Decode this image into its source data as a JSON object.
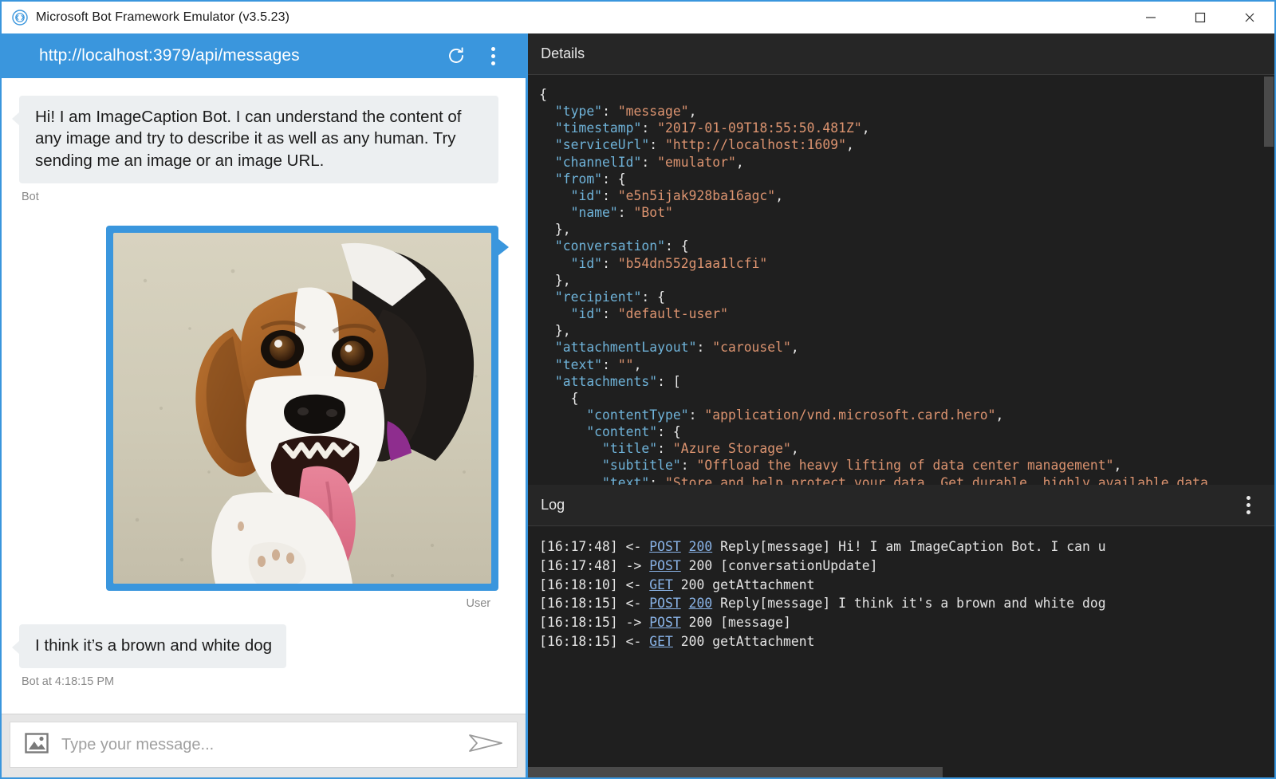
{
  "window": {
    "title": "Microsoft Bot Framework Emulator (v3.5.23)",
    "logo_icon": "bot-framework-logo-icon",
    "minimize_label": "—",
    "maximize_label": "□",
    "close_label": "×",
    "accent_color": "#3a96dd"
  },
  "endpoint": {
    "url": "http://localhost:3979/api/messages",
    "refresh_icon": "refresh-icon",
    "menu_icon": "more-vertical-icon"
  },
  "transcript": {
    "messages": [
      {
        "from": "bot",
        "kind": "text",
        "text": "Hi! I am ImageCaption Bot. I can understand the content of any image and try to describe it as well as any human. Try sending me an image or an image URL.",
        "meta": "Bot"
      },
      {
        "from": "user",
        "kind": "image",
        "alt": "Beagle dog with tongue out looking up at camera on concrete",
        "meta": "User"
      },
      {
        "from": "bot",
        "kind": "text",
        "text": "I think it’s a brown and white dog",
        "meta": "Bot at 4:18:15 PM"
      }
    ]
  },
  "composer": {
    "attach_icon": "image-attachment-icon",
    "placeholder": "Type your message...",
    "value": "",
    "send_icon": "send-icon"
  },
  "details": {
    "title": "Details",
    "menu_icon": "more-vertical-icon",
    "json_lines": [
      [
        [
          "p",
          "{"
        ]
      ],
      [
        [
          "p",
          "  "
        ],
        [
          "k",
          "\"type\""
        ],
        [
          "p",
          ": "
        ],
        [
          "s",
          "\"message\""
        ],
        [
          "p",
          ","
        ]
      ],
      [
        [
          "p",
          "  "
        ],
        [
          "k",
          "\"timestamp\""
        ],
        [
          "p",
          ": "
        ],
        [
          "s",
          "\"2017-01-09T18:55:50.481Z\""
        ],
        [
          "p",
          ","
        ]
      ],
      [
        [
          "p",
          "  "
        ],
        [
          "k",
          "\"serviceUrl\""
        ],
        [
          "p",
          ": "
        ],
        [
          "s",
          "\"http://localhost:1609\""
        ],
        [
          "p",
          ","
        ]
      ],
      [
        [
          "p",
          "  "
        ],
        [
          "k",
          "\"channelId\""
        ],
        [
          "p",
          ": "
        ],
        [
          "s",
          "\"emulator\""
        ],
        [
          "p",
          ","
        ]
      ],
      [
        [
          "p",
          "  "
        ],
        [
          "k",
          "\"from\""
        ],
        [
          "p",
          ": {"
        ]
      ],
      [
        [
          "p",
          "    "
        ],
        [
          "k",
          "\"id\""
        ],
        [
          "p",
          ": "
        ],
        [
          "s",
          "\"e5n5ijak928ba16agc\""
        ],
        [
          "p",
          ","
        ]
      ],
      [
        [
          "p",
          "    "
        ],
        [
          "k",
          "\"name\""
        ],
        [
          "p",
          ": "
        ],
        [
          "s",
          "\"Bot\""
        ]
      ],
      [
        [
          "p",
          "  },"
        ]
      ],
      [
        [
          "p",
          "  "
        ],
        [
          "k",
          "\"conversation\""
        ],
        [
          "p",
          ": {"
        ]
      ],
      [
        [
          "p",
          "    "
        ],
        [
          "k",
          "\"id\""
        ],
        [
          "p",
          ": "
        ],
        [
          "s",
          "\"b54dn552g1aa1lcfi\""
        ]
      ],
      [
        [
          "p",
          "  },"
        ]
      ],
      [
        [
          "p",
          "  "
        ],
        [
          "k",
          "\"recipient\""
        ],
        [
          "p",
          ": {"
        ]
      ],
      [
        [
          "p",
          "    "
        ],
        [
          "k",
          "\"id\""
        ],
        [
          "p",
          ": "
        ],
        [
          "s",
          "\"default-user\""
        ]
      ],
      [
        [
          "p",
          "  },"
        ]
      ],
      [
        [
          "p",
          "  "
        ],
        [
          "k",
          "\"attachmentLayout\""
        ],
        [
          "p",
          ": "
        ],
        [
          "s",
          "\"carousel\""
        ],
        [
          "p",
          ","
        ]
      ],
      [
        [
          "p",
          "  "
        ],
        [
          "k",
          "\"text\""
        ],
        [
          "p",
          ": "
        ],
        [
          "s",
          "\"\""
        ],
        [
          "p",
          ","
        ]
      ],
      [
        [
          "p",
          "  "
        ],
        [
          "k",
          "\"attachments\""
        ],
        [
          "p",
          ": ["
        ]
      ],
      [
        [
          "p",
          "    {"
        ]
      ],
      [
        [
          "p",
          "      "
        ],
        [
          "k",
          "\"contentType\""
        ],
        [
          "p",
          ": "
        ],
        [
          "s",
          "\"application/vnd.microsoft.card.hero\""
        ],
        [
          "p",
          ","
        ]
      ],
      [
        [
          "p",
          "      "
        ],
        [
          "k",
          "\"content\""
        ],
        [
          "p",
          ": {"
        ]
      ],
      [
        [
          "p",
          "        "
        ],
        [
          "k",
          "\"title\""
        ],
        [
          "p",
          ": "
        ],
        [
          "s",
          "\"Azure Storage\""
        ],
        [
          "p",
          ","
        ]
      ],
      [
        [
          "p",
          "        "
        ],
        [
          "k",
          "\"subtitle\""
        ],
        [
          "p",
          ": "
        ],
        [
          "s",
          "\"Offload the heavy lifting of data center management\""
        ],
        [
          "p",
          ","
        ]
      ],
      [
        [
          "p",
          "        "
        ],
        [
          "k",
          "\"text\""
        ],
        [
          "p",
          ": "
        ],
        [
          "s",
          "\"Store and help protect your data. Get durable, highly available data storage across the globe and pay only for"
        ]
      ]
    ],
    "scrollbar": "vertical-scrollbar"
  },
  "log": {
    "title": "Log",
    "menu_icon": "more-vertical-icon",
    "entries": [
      {
        "time": "[16:17:48]",
        "dir": "<-",
        "verb": "POST",
        "status": "200",
        "status_link": true,
        "rest": " Reply[message] Hi! I am ImageCaption Bot. I can u"
      },
      {
        "time": "[16:17:48]",
        "dir": "->",
        "verb": "POST",
        "status": "200",
        "status_link": false,
        "rest": " [conversationUpdate]"
      },
      {
        "time": "[16:18:10]",
        "dir": "<-",
        "verb": "GET",
        "status": "200",
        "status_link": false,
        "rest": " getAttachment"
      },
      {
        "time": "[16:18:15]",
        "dir": "<-",
        "verb": "POST",
        "status": "200",
        "status_link": true,
        "rest": " Reply[message] I think it's a brown and white dog"
      },
      {
        "time": "[16:18:15]",
        "dir": "->",
        "verb": "POST",
        "status": "200",
        "status_link": false,
        "rest": " [message]"
      },
      {
        "time": "[16:18:15]",
        "dir": "<-",
        "verb": "GET",
        "status": "200",
        "status_link": false,
        "rest": " getAttachment"
      }
    ],
    "scrollbar": "horizontal-scrollbar"
  }
}
